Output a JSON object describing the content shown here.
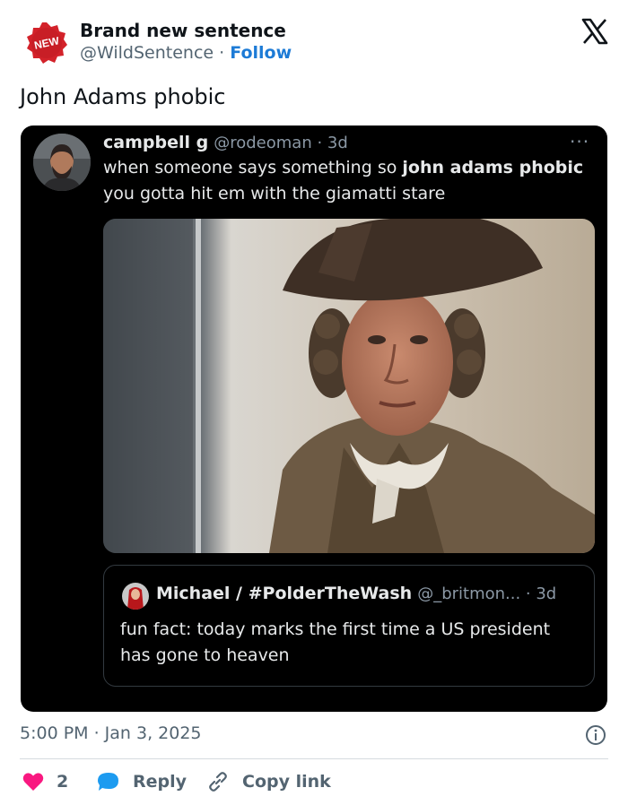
{
  "header": {
    "badge_text": "NEW",
    "name": "Brand new sentence",
    "handle": "@WildSentence",
    "separator": "·",
    "follow_label": "Follow"
  },
  "tweet": {
    "text": "John Adams phobic",
    "timestamp": "5:00 PM · Jan 3, 2025"
  },
  "embedded": {
    "name": "campbell g",
    "handle": "@rodeoman · 3d",
    "more_label": "···",
    "line1_prefix": "when someone says something so ",
    "line1_bold": "john adams phobic",
    "line2": "you gotta hit em with the giamatti stare",
    "quote": {
      "name": "Michael / #PolderTheWash",
      "handle": "@_britmon... · 3d",
      "line1": "fun fact: today marks the first time a US president",
      "line2": "has gone to heaven"
    }
  },
  "actions": {
    "like_count": "2",
    "reply_label": "Reply",
    "copy_label": "Copy link"
  },
  "icons": {
    "avatar": "new-badge-icon",
    "logo": "x-logo-icon",
    "info": "info-icon",
    "like": "heart-icon",
    "reply": "speech-bubble-icon",
    "copy": "link-icon"
  },
  "colors": {
    "follow": "#1d7bd6",
    "like": "#f91880",
    "reply": "#1d9bf0",
    "card_bg": "#000000",
    "avatar_badge": "#d3222a"
  }
}
